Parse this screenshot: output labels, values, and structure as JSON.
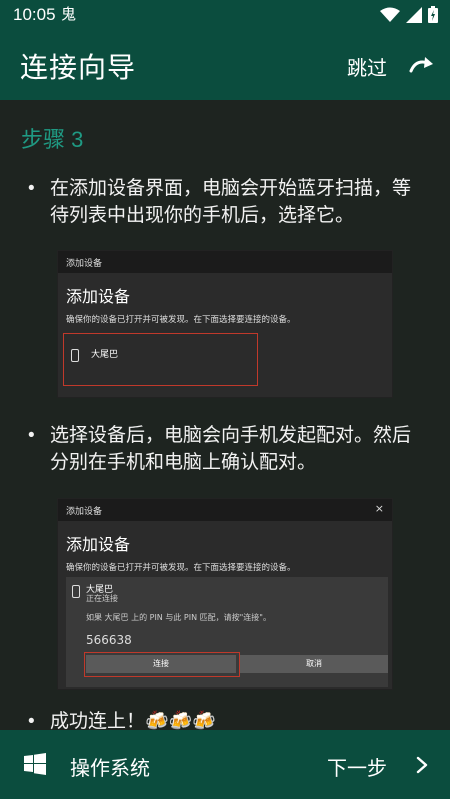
{
  "status": {
    "time": "10:05",
    "notif_glyph": "开"
  },
  "appbar": {
    "title": "连接向导",
    "skip_label": "跳过"
  },
  "content": {
    "step_heading": "步骤 3",
    "bullet1": "在添加设备界面，电脑会开始蓝牙扫描，等待列表中出现你的手机后，选择它。",
    "bullet2": "选择设备后，电脑会向手机发起配对。然后分别在手机和电脑上确认配对。",
    "bullet3": "成功连上！🍻🍻🍻",
    "shot1": {
      "window_title": "添加设备",
      "heading": "添加设备",
      "subtitle": "确保你的设备已打开并可被发现。在下面选择要连接的设备。",
      "device_name": "大尾巴"
    },
    "shot2": {
      "window_title": "添加设备",
      "close": "×",
      "heading": "添加设备",
      "subtitle": "确保你的设备已打开并可被发现。在下面选择要连接的设备。",
      "device_name": "大尾巴",
      "device_status": "正在连接",
      "pin_prompt": "如果 大尾巴 上的 PIN 与此 PIN 匹配，请按\"连接\"。",
      "pin": "566638",
      "connect_label": "连接",
      "cancel_label": "取消"
    }
  },
  "bottombar": {
    "os_label": "操作系统",
    "next_label": "下一步"
  },
  "colors": {
    "primary": "#0b4d3e",
    "accent": "#1f9a83",
    "background": "#1e2420"
  }
}
